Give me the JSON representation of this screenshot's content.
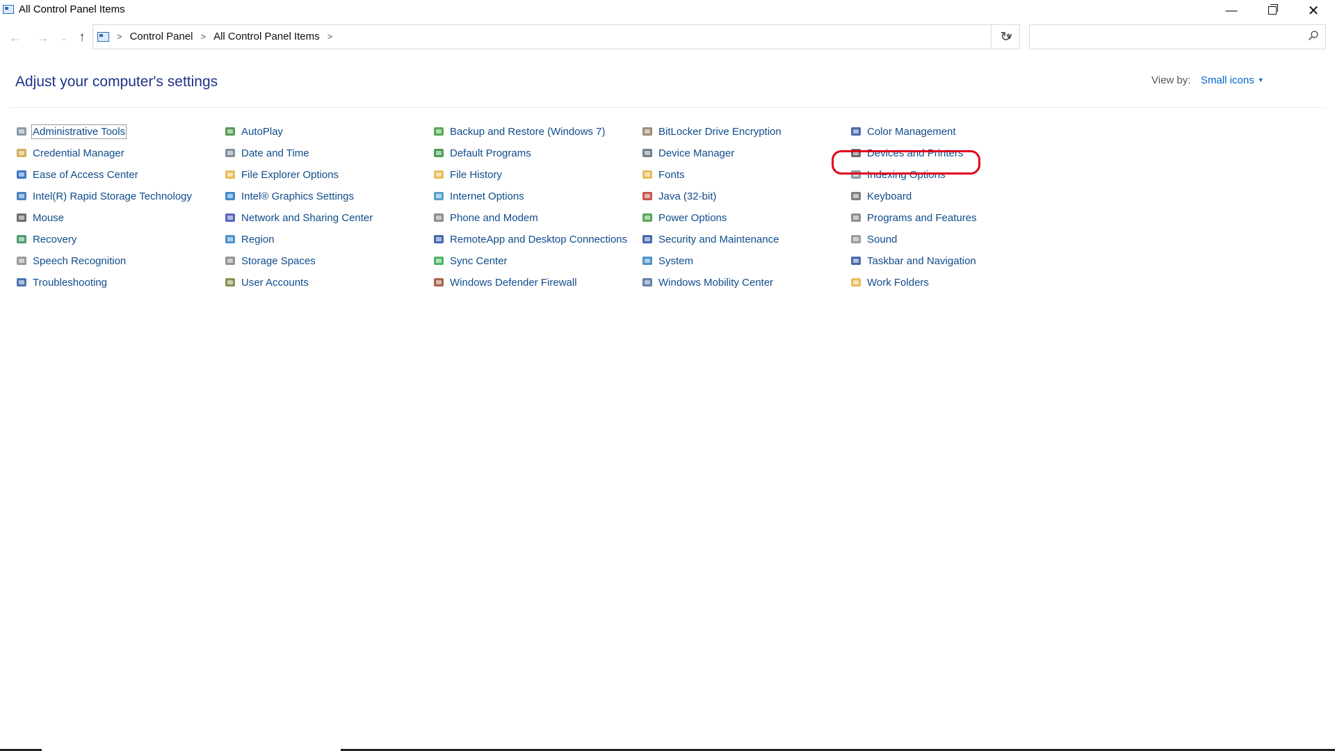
{
  "window": {
    "title": "All Control Panel Items",
    "controls": {
      "minimize": "—",
      "close": "✕"
    }
  },
  "nav": {
    "back": "←",
    "forward": "→",
    "recent": "⌄",
    "up": "↑",
    "breadcrumb": [
      "Control Panel",
      "All Control Panel Items"
    ],
    "refresh": "↻",
    "search_value": ""
  },
  "header": {
    "title": "Adjust your computer's settings",
    "view_by_label": "View by:",
    "view_by_value": "Small icons"
  },
  "items": [
    {
      "label": "Administrative Tools",
      "icon": "admin-tools-icon",
      "color": "#7a8a9a"
    },
    {
      "label": "Credential Manager",
      "icon": "credential-manager-icon",
      "color": "#c9a13b"
    },
    {
      "label": "Ease of Access Center",
      "icon": "ease-of-access-icon",
      "color": "#1f5fbf"
    },
    {
      "label": "Intel(R) Rapid Storage Technology",
      "icon": "intel-rst-icon",
      "color": "#2c6fb7"
    },
    {
      "label": "Mouse",
      "icon": "mouse-icon",
      "color": "#555555"
    },
    {
      "label": "Recovery",
      "icon": "recovery-icon",
      "color": "#2e8b57"
    },
    {
      "label": "Speech Recognition",
      "icon": "microphone-icon",
      "color": "#8a8a8a"
    },
    {
      "label": "Troubleshooting",
      "icon": "troubleshooting-icon",
      "color": "#2b5ea7"
    },
    {
      "label": "AutoPlay",
      "icon": "autoplay-icon",
      "color": "#3a8a3a"
    },
    {
      "label": "Date and Time",
      "icon": "clock-icon",
      "color": "#6b7b8c"
    },
    {
      "label": "File Explorer Options",
      "icon": "folder-options-icon",
      "color": "#e3b23c"
    },
    {
      "label": "Intel® Graphics Settings",
      "icon": "intel-graphics-icon",
      "color": "#1d74c4"
    },
    {
      "label": "Network and Sharing Center",
      "icon": "network-icon",
      "color": "#3b4bb0"
    },
    {
      "label": "Region",
      "icon": "globe-clock-icon",
      "color": "#2f7fbf"
    },
    {
      "label": "Storage Spaces",
      "icon": "storage-spaces-icon",
      "color": "#808080"
    },
    {
      "label": "User Accounts",
      "icon": "user-accounts-icon",
      "color": "#6d7f3a"
    },
    {
      "label": "Backup and Restore (Windows 7)",
      "icon": "backup-icon",
      "color": "#3a9a3a"
    },
    {
      "label": "Default Programs",
      "icon": "default-programs-icon",
      "color": "#2e8b3a"
    },
    {
      "label": "File History",
      "icon": "file-history-icon",
      "color": "#e3b23c"
    },
    {
      "label": "Internet Options",
      "icon": "internet-options-icon",
      "color": "#3a8fbf"
    },
    {
      "label": "Phone and Modem",
      "icon": "phone-modem-icon",
      "color": "#7a7a7a"
    },
    {
      "label": "RemoteApp and Desktop Connections",
      "icon": "remoteapp-icon",
      "color": "#2a4fa0"
    },
    {
      "label": "Sync Center",
      "icon": "sync-center-icon",
      "color": "#2ea84a"
    },
    {
      "label": "Windows Defender Firewall",
      "icon": "firewall-icon",
      "color": "#9a4a2a"
    },
    {
      "label": "BitLocker Drive Encryption",
      "icon": "bitlocker-icon",
      "color": "#8a7a5a"
    },
    {
      "label": "Device Manager",
      "icon": "device-manager-icon",
      "color": "#5a6a7a"
    },
    {
      "label": "Fonts",
      "icon": "fonts-icon",
      "color": "#e3b23c"
    },
    {
      "label": "Java (32-bit)",
      "icon": "java-icon",
      "color": "#c0392b"
    },
    {
      "label": "Power Options",
      "icon": "power-options-icon",
      "color": "#3a9a3a"
    },
    {
      "label": "Security and Maintenance",
      "icon": "security-flag-icon",
      "color": "#2a4fa0"
    },
    {
      "label": "System",
      "icon": "system-icon",
      "color": "#2f7fbf"
    },
    {
      "label": "Windows Mobility Center",
      "icon": "mobility-center-icon",
      "color": "#4a6a9a"
    },
    {
      "label": "Color Management",
      "icon": "color-management-icon",
      "color": "#2a4fa0"
    },
    {
      "label": "Devices and Printers",
      "icon": "printer-icon",
      "color": "#555555"
    },
    {
      "label": "Indexing Options",
      "icon": "indexing-icon",
      "color": "#7a8a9a"
    },
    {
      "label": "Keyboard",
      "icon": "keyboard-icon",
      "color": "#6a6a6a"
    },
    {
      "label": "Programs and Features",
      "icon": "programs-features-icon",
      "color": "#7a7a7a"
    },
    {
      "label": "Sound",
      "icon": "speaker-icon",
      "color": "#8a8a8a"
    },
    {
      "label": "Taskbar and Navigation",
      "icon": "taskbar-icon",
      "color": "#2a4fa0"
    },
    {
      "label": "Work Folders",
      "icon": "work-folders-icon",
      "color": "#e3b23c"
    }
  ],
  "colors": {
    "link": "#0f4c8b",
    "heading": "#1e3287",
    "annotation": "#e0001b"
  }
}
